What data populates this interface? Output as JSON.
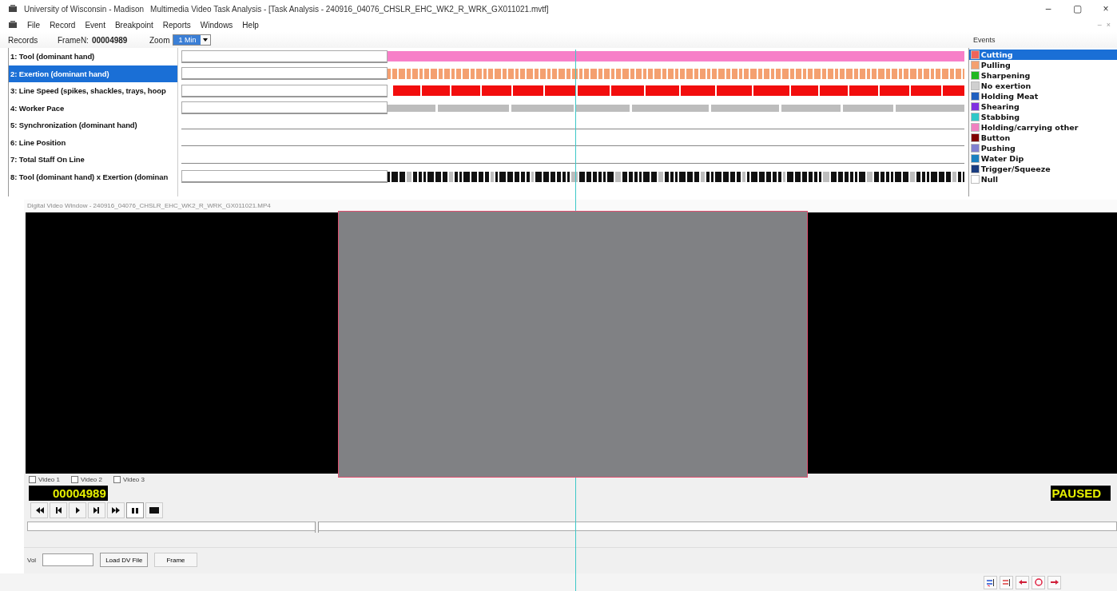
{
  "window": {
    "title_org": "University of Wisconsin - Madison",
    "title": "Multimedia Video Task Analysis - [Task Analysis - 240916_04076_CHSLR_EHC_WK2_R_WRK_GX011021.mvtf]",
    "controls": [
      "–",
      "▢",
      "×"
    ]
  },
  "menu": [
    "File",
    "Record",
    "Event",
    "Breakpoint",
    "Reports",
    "Windows",
    "Help"
  ],
  "mdi_controls": [
    "–",
    "×"
  ],
  "toolbar": {
    "records_label": "Records",
    "frame_label": "FrameN:",
    "frame_value": "00004989",
    "zoom_label": "Zoom",
    "zoom_value": "1 Min"
  },
  "tracks": [
    {
      "label": "1: Tool (dominant hand)",
      "selected": false,
      "kind": "solid",
      "color": "#f77fc8"
    },
    {
      "label": "2: Exertion (dominant hand)",
      "selected": true,
      "kind": "mixed",
      "color": "#f4a070"
    },
    {
      "label": "3: Line Speed (spikes, shackles, trays, hoop",
      "selected": false,
      "kind": "blocks",
      "color": "#f20d0d"
    },
    {
      "label": "4: Worker Pace",
      "selected": false,
      "kind": "wide",
      "color": "#bdbdbd"
    },
    {
      "label": "5: Synchronization (dominant hand)",
      "selected": false,
      "kind": "empty"
    },
    {
      "label": "6: Line Position",
      "selected": false,
      "kind": "empty"
    },
    {
      "label": "7: Total Staff On Line",
      "selected": false,
      "kind": "empty"
    },
    {
      "label": "8: Tool (dominant hand) x Exertion (dominan",
      "selected": false,
      "kind": "barcode",
      "color": "#111111"
    }
  ],
  "events": {
    "title": "Events",
    "items": [
      {
        "label": "Cutting",
        "selected": true,
        "color": "#f0645a"
      },
      {
        "label": "Pulling",
        "selected": false,
        "color": "#f4a070"
      },
      {
        "label": "Sharpening",
        "selected": false,
        "color": "#22b822"
      },
      {
        "label": "No exertion",
        "selected": false,
        "color": "#d0d0d0"
      },
      {
        "label": "Holding Meat",
        "selected": false,
        "color": "#2060c0"
      },
      {
        "label": "Shearing",
        "selected": false,
        "color": "#8030e0"
      },
      {
        "label": "Stabbing",
        "selected": false,
        "color": "#30c8c8"
      },
      {
        "label": "Holding/carrying other",
        "selected": false,
        "color": "#f080c0"
      },
      {
        "label": "Button",
        "selected": false,
        "color": "#800000"
      },
      {
        "label": "Pushing",
        "selected": false,
        "color": "#8080d0"
      },
      {
        "label": "Water Dip",
        "selected": false,
        "color": "#1a80c0"
      },
      {
        "label": "Trigger/Squeeze",
        "selected": false,
        "color": "#1a3c80"
      },
      {
        "label": "Null",
        "selected": false,
        "color": "#ffffff"
      }
    ]
  },
  "video": {
    "title": "Digital Video Window - 240916_04076_CHSLR_EHC_WK2_R_WRK_GX011021.MP4",
    "sources": [
      {
        "label": "Video 1",
        "checked": false
      },
      {
        "label": "Video 2",
        "checked": false
      },
      {
        "label": "Video 3",
        "checked": false
      }
    ],
    "seek": {
      "level": 0.265
    },
    "timecode": "00004989",
    "status": "PAUSED",
    "transport": [
      {
        "kind": "rewind",
        "selected": false
      },
      {
        "kind": "step-back",
        "selected": false
      },
      {
        "kind": "play",
        "selected": false
      },
      {
        "kind": "step-forward",
        "selected": false
      },
      {
        "kind": "fast-forward",
        "selected": false
      },
      {
        "kind": "pause",
        "selected": true
      },
      {
        "kind": "stop",
        "selected": false
      }
    ],
    "vol_label": "Vol",
    "buttons": [
      "Load DV File",
      "Frame"
    ]
  }
}
